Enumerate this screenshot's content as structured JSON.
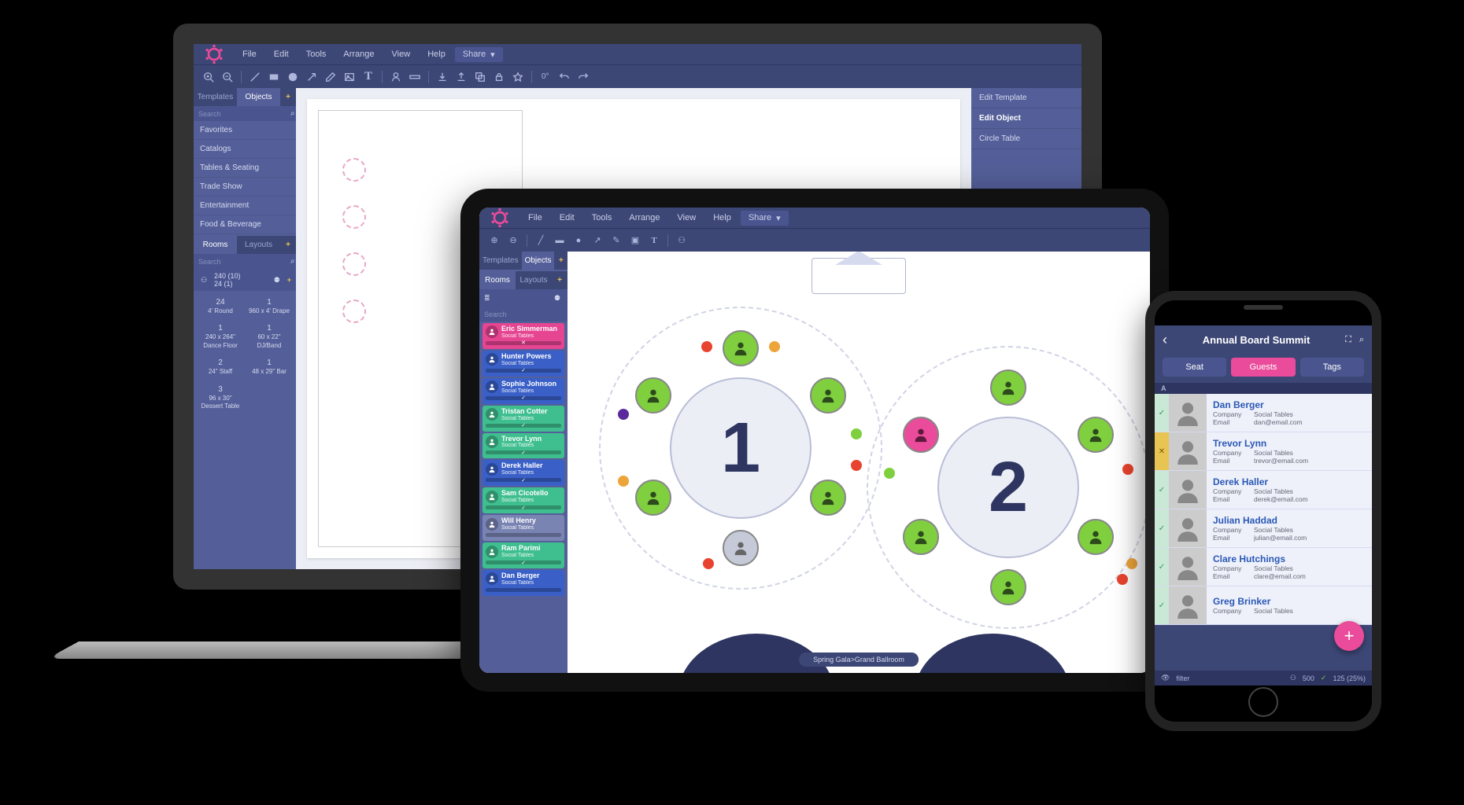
{
  "colors": {
    "accent": "#ea4b9a",
    "primary": "#3d4776",
    "panel": "#545f99"
  },
  "menubar": {
    "file": "File",
    "edit": "Edit",
    "tools": "Tools",
    "arrange": "Arrange",
    "view": "View",
    "help": "Help",
    "share": "Share"
  },
  "toolbar": {
    "rotation": "0°"
  },
  "left": {
    "tabs": {
      "templates": "Templates",
      "objects": "Objects"
    },
    "search_ph": "Search",
    "categories": [
      "Favorites",
      "Catalogs",
      "Tables & Seating",
      "Trade Show",
      "Entertainment",
      "Food & Beverage"
    ],
    "sec_tabs": {
      "rooms": "Rooms",
      "layouts": "Layouts"
    },
    "room_counts": {
      "a": "240 (10)",
      "b": "24 (1)"
    },
    "objects_grid": [
      {
        "n": "24",
        "d": "4' Round"
      },
      {
        "n": "1",
        "d": "960 x 4' Drape"
      },
      {
        "n": "1",
        "d": "240 x 264\" Dance Floor"
      },
      {
        "n": "1",
        "d": "60 x 22\" DJ/Band"
      },
      {
        "n": "2",
        "d": "24\" Staff"
      },
      {
        "n": "1",
        "d": "48 x 29\" Bar"
      },
      {
        "n": "3",
        "d": "96 x 30\" Dessert Table"
      }
    ]
  },
  "right": {
    "edit_template": "Edit Template",
    "edit_object": "Edit Object",
    "circle_table": "Circle Table"
  },
  "tablet_guests": [
    {
      "name": "Eric Simmerman",
      "company": "Social Tables",
      "style": "pink",
      "mark": "✕"
    },
    {
      "name": "Hunter Powers",
      "company": "Social Tables",
      "style": "blue",
      "mark": "✓"
    },
    {
      "name": "Sophie Johnson",
      "company": "Social Tables",
      "style": "blue",
      "mark": "✓"
    },
    {
      "name": "Tristan Cotter",
      "company": "Social Tables",
      "style": "green",
      "mark": "✓"
    },
    {
      "name": "Trevor Lynn",
      "company": "Social Tables",
      "style": "green",
      "mark": "✓"
    },
    {
      "name": "Derek Haller",
      "company": "Social Tables",
      "style": "blue",
      "mark": "✓"
    },
    {
      "name": "Sam Cicotello",
      "company": "Social Tables",
      "style": "green",
      "mark": "✓"
    },
    {
      "name": "Will Henry",
      "company": "Social Tables",
      "style": "grey",
      "mark": ""
    },
    {
      "name": "Ram Parimi",
      "company": "Social Tables",
      "style": "green",
      "mark": "✓"
    },
    {
      "name": "Dan Berger",
      "company": "Social Tables",
      "style": "blue",
      "mark": ""
    }
  ],
  "tables": {
    "t1": "1",
    "t2": "2"
  },
  "breadcrumb": "Spring Gala>Grand Ballroom",
  "phone": {
    "title": "Annual Board Summit",
    "tabs": {
      "seat": "Seat",
      "guests": "Guests",
      "tags": "Tags"
    },
    "letter": "A",
    "footer": {
      "filter": "filter",
      "count": "500",
      "checked": "125 (25%)"
    },
    "guests": [
      {
        "name": "Dan Berger",
        "company": "Social Tables",
        "email": "dan@email.com",
        "ok": true
      },
      {
        "name": "Trevor Lynn",
        "company": "Social Tables",
        "email": "trevor@email.com",
        "ok": false
      },
      {
        "name": "Derek Haller",
        "company": "Social Tables",
        "email": "derek@email.com",
        "ok": true
      },
      {
        "name": "Julian Haddad",
        "company": "Social Tables",
        "email": "julian@email.com",
        "ok": true
      },
      {
        "name": "Clare Hutchings",
        "company": "Social Tables",
        "email": "clare@email.com",
        "ok": true
      },
      {
        "name": "Greg Brinker",
        "company": "Social Tables",
        "email": "",
        "ok": true
      }
    ],
    "labels": {
      "company": "Company",
      "email": "Email"
    }
  }
}
